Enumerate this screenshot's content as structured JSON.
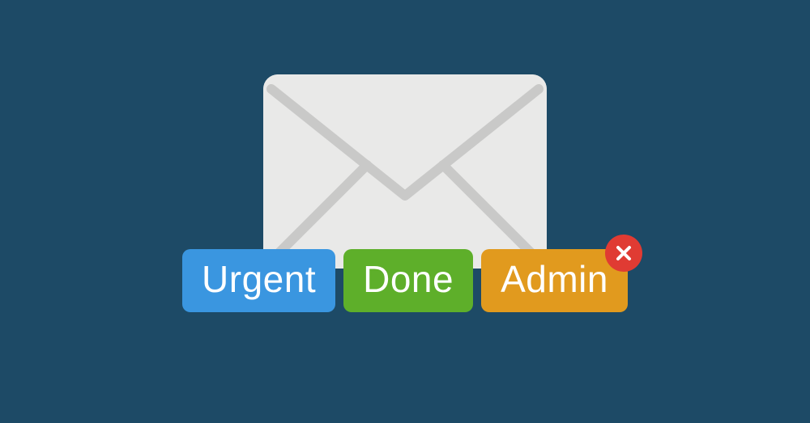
{
  "tags": {
    "urgent": {
      "label": "Urgent",
      "color": "#3a96e0"
    },
    "done": {
      "label": "Done",
      "color": "#5eaf2a"
    },
    "admin": {
      "label": "Admin",
      "color": "#e19a1e"
    }
  },
  "icons": {
    "envelope": "envelope-icon",
    "remove": "close-icon"
  },
  "colors": {
    "background": "#1d4a66",
    "envelope_body": "#e9e9e8",
    "envelope_lines": "#c9c9c8",
    "remove_badge": "#e03b33"
  }
}
